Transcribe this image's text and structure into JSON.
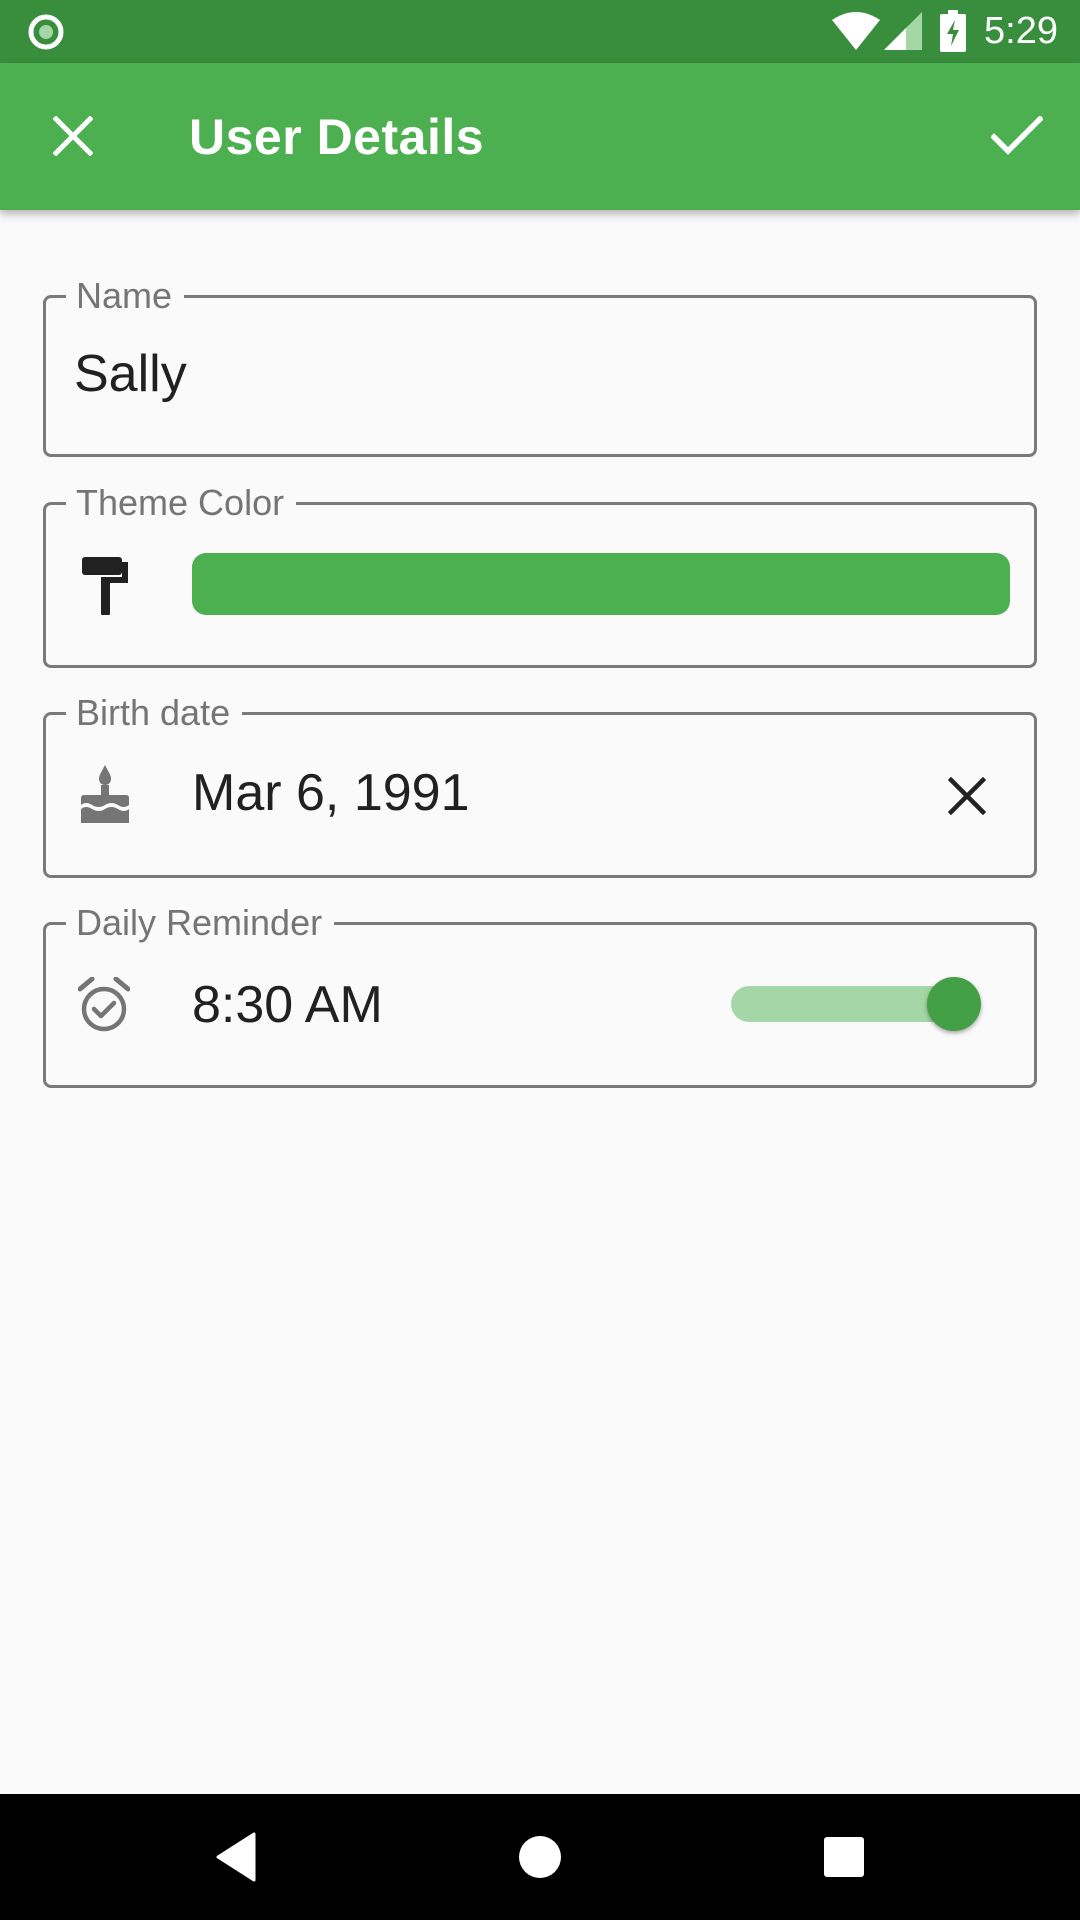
{
  "status_bar": {
    "time": "5:29",
    "notification_icon": "circle-notification-icon",
    "wifi_icon": "wifi-icon",
    "signal_icon": "cell-signal-icon",
    "battery_icon": "battery-charging-icon",
    "background_color": "#388e3c"
  },
  "app_bar": {
    "title": "User Details",
    "close_icon": "close-icon",
    "confirm_icon": "check-icon",
    "background_color": "#4caf50"
  },
  "form": {
    "name": {
      "label": "Name",
      "value": "Sally"
    },
    "theme_color": {
      "label": "Theme Color",
      "icon": "paint-roller-icon",
      "color": "#4caf50"
    },
    "birth_date": {
      "label": "Birth date",
      "icon": "cake-icon",
      "value": "Mar 6, 1991",
      "clear_icon": "clear-icon"
    },
    "daily_reminder": {
      "label": "Daily Reminder",
      "icon": "alarm-check-icon",
      "value": "8:30 AM",
      "enabled": true,
      "track_color": "#a5d6a7",
      "thumb_color": "#43a047"
    }
  },
  "nav_bar": {
    "back_icon": "back-triangle-icon",
    "home_icon": "home-circle-icon",
    "recents_icon": "recents-square-icon"
  }
}
